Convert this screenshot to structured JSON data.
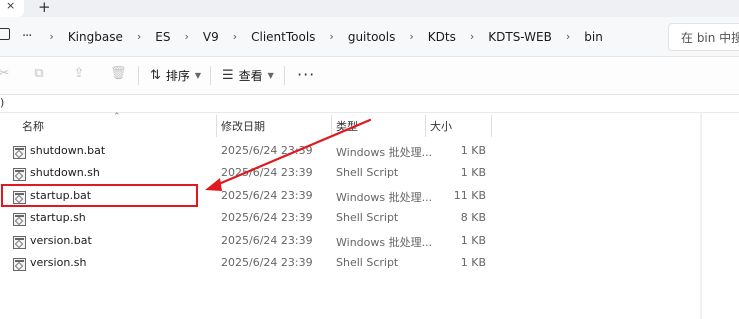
{
  "tabbar": {
    "close_glyph": "×",
    "new_tab_glyph": "+"
  },
  "address": {
    "ellipsis": "···",
    "breadcrumbs": [
      "Kingbase",
      "ES",
      "V9",
      "ClientTools",
      "guitools",
      "KDts",
      "KDTS-WEB",
      "bin"
    ],
    "separator": "›",
    "search_placeholder": "在 bin 中搜索"
  },
  "toolbar": {
    "sort_label": "排序",
    "view_label": "查看",
    "more_glyph": "···"
  },
  "leftpane": {
    "label": ")"
  },
  "columns": {
    "name": "名称",
    "modified": "修改日期",
    "type": "类型",
    "size": "大小"
  },
  "files": [
    {
      "name": "shutdown.bat",
      "modified": "2025/6/24 23:39",
      "type": "Windows 批处理...",
      "size": "1 KB"
    },
    {
      "name": "shutdown.sh",
      "modified": "2025/6/24 23:39",
      "type": "Shell Script",
      "size": "1 KB"
    },
    {
      "name": "startup.bat",
      "modified": "2025/6/24 23:39",
      "type": "Windows 批处理...",
      "size": "11 KB"
    },
    {
      "name": "startup.sh",
      "modified": "2025/6/24 23:39",
      "type": "Shell Script",
      "size": "8 KB"
    },
    {
      "name": "version.bat",
      "modified": "2025/6/24 23:39",
      "type": "Windows 批处理...",
      "size": "1 KB"
    },
    {
      "name": "version.sh",
      "modified": "2025/6/24 23:39",
      "type": "Shell Script",
      "size": "1 KB"
    }
  ],
  "annotation": {
    "color": "#e0191e",
    "highlighted_file": "startup.bat"
  },
  "icons": {
    "toolbar_disabled": [
      "cut-icon",
      "copy-icon",
      "share-icon",
      "delete-icon"
    ],
    "sort": "sort-icon",
    "view": "view-icon"
  }
}
